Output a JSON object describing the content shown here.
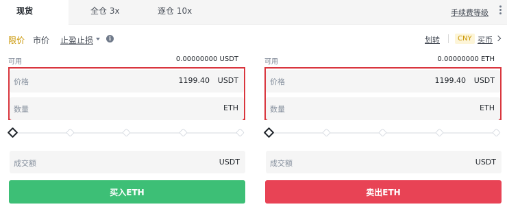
{
  "tabs": [
    {
      "label": "现货",
      "active": true
    },
    {
      "label": "全仓 3x",
      "active": false
    },
    {
      "label": "逐仓 10x",
      "active": false
    }
  ],
  "fee_level_link": "手续费等级",
  "order_types": {
    "limit": "限价",
    "market": "市价",
    "stop_limit": "止盈止损"
  },
  "transfer_link": "划转",
  "currency_badge": "CNY",
  "buy_crypto_link": "买币",
  "buy_panel": {
    "available_label": "可用",
    "available_value": "0.00000000 USDT",
    "price_label": "价格",
    "price_value": "1199.40",
    "price_unit": "USDT",
    "qty_label": "数量",
    "qty_value": "",
    "qty_unit": "ETH",
    "slider_percent": 0,
    "total_label": "成交额",
    "total_unit": "USDT",
    "button_label": "买入ETH"
  },
  "sell_panel": {
    "available_label": "可用",
    "available_value": "0.00000000 ETH",
    "price_label": "价格",
    "price_value": "1199.40",
    "price_unit": "USDT",
    "qty_label": "数量",
    "qty_value": "",
    "qty_unit": "ETH",
    "slider_percent": 0,
    "total_label": "成交额",
    "total_unit": "USDT",
    "button_label": "卖出ETH"
  },
  "colors": {
    "accent": "#c99400",
    "buy": "#3dbf76",
    "sell": "#e84355",
    "highlight_box": "#d9363e"
  },
  "icons": [
    "more-vertical-icon",
    "caret-down-icon",
    "info-icon",
    "chevron-right-icon",
    "slider-handle-icon"
  ]
}
